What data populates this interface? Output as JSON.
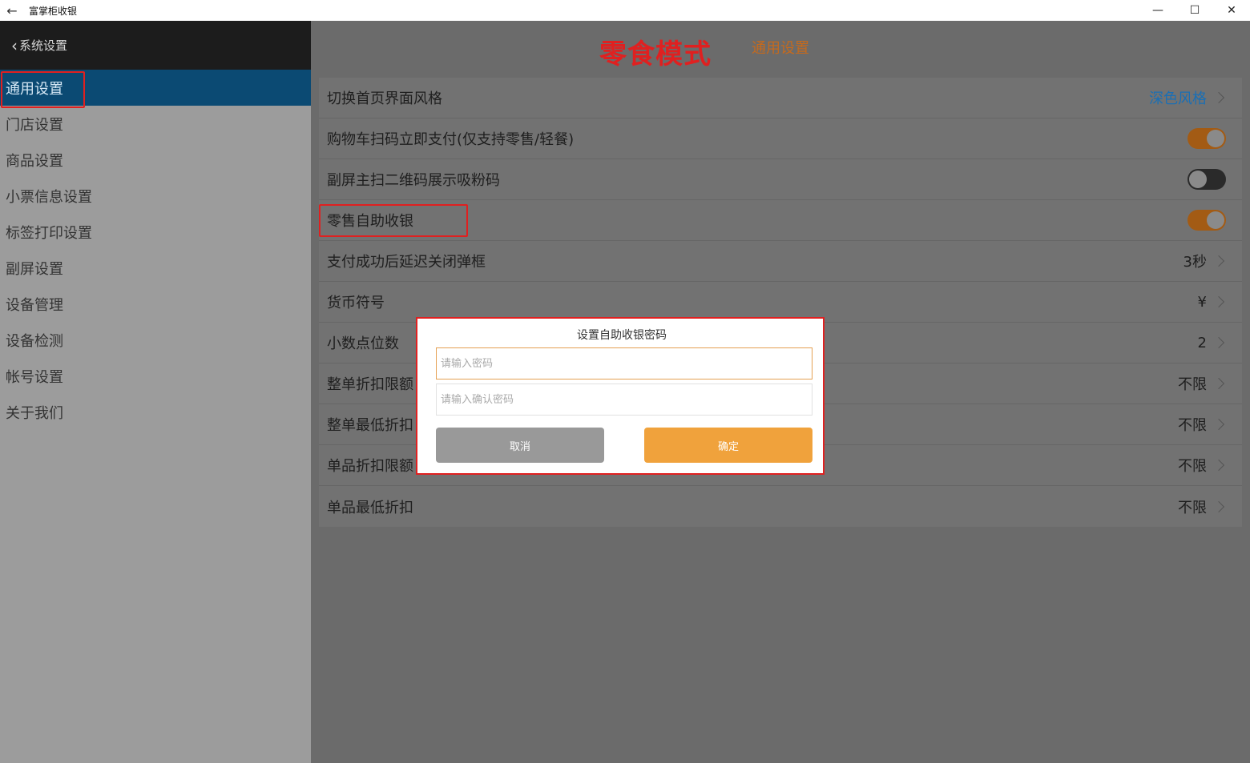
{
  "window": {
    "title": "富掌柜收银",
    "back_icon": "←",
    "minimize_icon": "—",
    "maximize_icon": "☐",
    "close_icon": "✕"
  },
  "sidebar": {
    "header_label": "系统设置",
    "items": [
      {
        "label": "通用设置",
        "active": true
      },
      {
        "label": "门店设置"
      },
      {
        "label": "商品设置"
      },
      {
        "label": "小票信息设置"
      },
      {
        "label": "标签打印设置"
      },
      {
        "label": "副屏设置"
      },
      {
        "label": "设备管理"
      },
      {
        "label": "设备检测"
      },
      {
        "label": "帐号设置"
      },
      {
        "label": "关于我们"
      }
    ]
  },
  "header": {
    "mode_title": "零食模式",
    "section_title": "通用设置"
  },
  "settings": {
    "rows": [
      {
        "label": "切换首页界面风格",
        "value": "深色风格",
        "type": "link"
      },
      {
        "label": "购物车扫码立即支付(仅支持零售/轻餐)",
        "type": "toggle",
        "on": true
      },
      {
        "label": "副屏主扫二维码展示吸粉码",
        "type": "toggle",
        "on": false
      },
      {
        "label": "零售自助收银",
        "type": "toggle",
        "on": true
      },
      {
        "label": "支付成功后延迟关闭弹框",
        "value": "3秒",
        "type": "link"
      },
      {
        "label": "货币符号",
        "value": "¥",
        "type": "link"
      },
      {
        "label": "小数点位数",
        "value": "2",
        "type": "link"
      },
      {
        "label": "整单折扣限额",
        "value": "不限",
        "type": "link"
      },
      {
        "label": "整单最低折扣",
        "value": "不限",
        "type": "link"
      },
      {
        "label": "单品折扣限额",
        "value": "不限",
        "type": "link"
      },
      {
        "label": "单品最低折扣",
        "value": "不限",
        "type": "link"
      }
    ]
  },
  "dialog": {
    "title": "设置自助收银密码",
    "password_placeholder": "请输入密码",
    "confirm_placeholder": "请输入确认密码",
    "cancel_label": "取消",
    "ok_label": "确定"
  },
  "colors": {
    "accent_orange": "#f0a23c",
    "highlight_red": "#e02020",
    "sidebar_active": "#0b4a73",
    "link_blue": "#1a6fb5"
  }
}
